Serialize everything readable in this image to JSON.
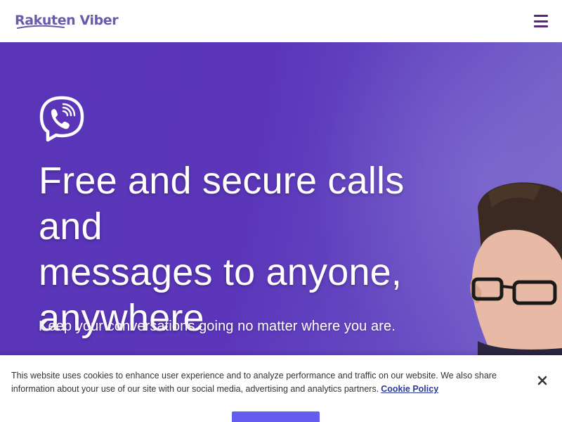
{
  "header": {
    "logo_text": "Rakuten Viber",
    "menu_icon": "hamburger-menu-icon"
  },
  "hero": {
    "logo_icon": "viber-phone-icon",
    "title_line1": "Free and secure calls and",
    "title_line2": "messages to anyone,",
    "title_line3": "anywhere",
    "subtitle": "Keep your conversations going no matter where you are."
  },
  "cookie_banner": {
    "text": "This website uses cookies to enhance user experience and to analyze performance and traffic on our website. We also share information about your use of our site with our social media, advertising and analytics partners.",
    "link_label": "Cookie Policy",
    "close_icon": "close-icon"
  },
  "colors": {
    "brand": "#665cac",
    "hero_bg": "#5a35b8",
    "menu": "#59267c",
    "link": "#2b3a9b",
    "button": "#665cf0"
  }
}
